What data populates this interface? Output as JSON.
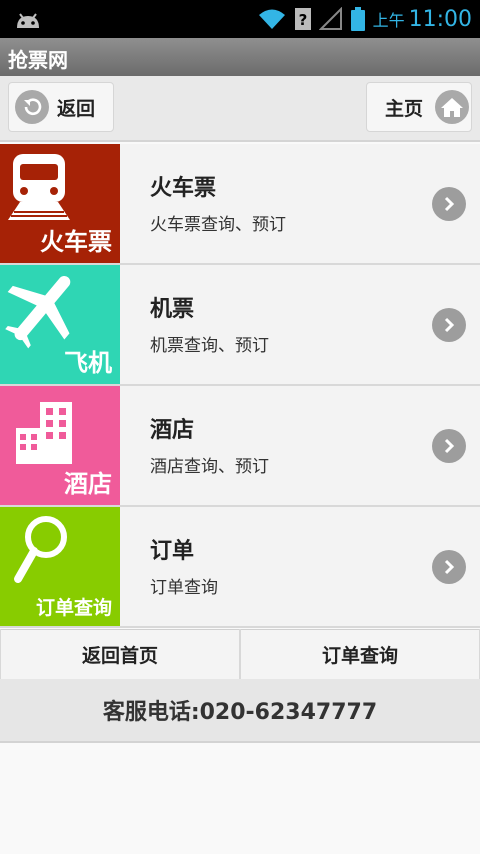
{
  "status_bar": {
    "ampm": "上午",
    "time": "11:00",
    "icons": [
      "android-icon",
      "wifi-icon",
      "no-sim-icon",
      "signal-icon",
      "battery-icon"
    ]
  },
  "app": {
    "title": "抢票网"
  },
  "nav": {
    "back_label": "返回",
    "home_label": "主页"
  },
  "items": [
    {
      "tile_label": "火车票",
      "title": "火车票",
      "subtitle": "火车票查询、预订",
      "color": "#a62206"
    },
    {
      "tile_label": "飞机",
      "title": "机票",
      "subtitle": "机票查询、预订",
      "color": "#2fd6b4"
    },
    {
      "tile_label": "酒店",
      "title": "酒店",
      "subtitle": "酒店查询、预订",
      "color": "#f05b9a"
    },
    {
      "tile_label": "订单查询",
      "title": "订单",
      "subtitle": "订单查询",
      "color": "#88cc00"
    }
  ],
  "bottom": {
    "home_label": "返回首页",
    "orders_label": "订单查询"
  },
  "service": {
    "text": "客服电话:020-62347777"
  }
}
